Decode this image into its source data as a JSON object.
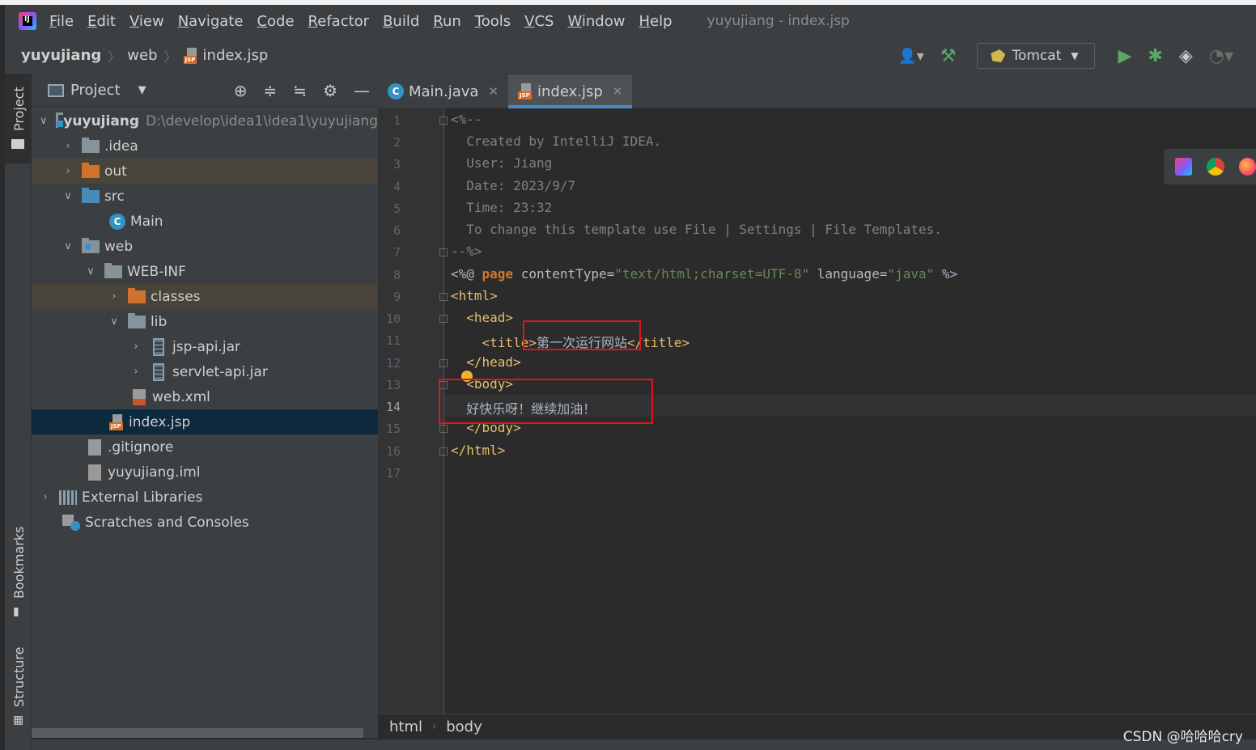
{
  "menu": {
    "items": [
      "File",
      "Edit",
      "View",
      "Navigate",
      "Code",
      "Refactor",
      "Build",
      "Run",
      "Tools",
      "VCS",
      "Window",
      "Help"
    ],
    "window_title": "yuyujiang - index.jsp"
  },
  "navbar": {
    "crumbs": [
      "yuyujiang",
      "web",
      "index.jsp"
    ],
    "run_config": "Tomcat"
  },
  "side_tabs": {
    "project": "Project",
    "bookmarks": "Bookmarks",
    "structure": "Structure"
  },
  "project_panel": {
    "title": "Project",
    "root_name": "yuyujiang",
    "root_path": "D:\\develop\\idea1\\idea1\\yuyujiang",
    "items": [
      ".idea",
      "out",
      "src",
      "Main",
      "web",
      "WEB-INF",
      "classes",
      "lib",
      "jsp-api.jar",
      "servlet-api.jar",
      "web.xml",
      "index.jsp",
      ".gitignore",
      "yuyujiang.iml",
      "External Libraries",
      "Scratches and Consoles"
    ]
  },
  "tabs": [
    {
      "label": "Main.java"
    },
    {
      "label": "index.jsp"
    }
  ],
  "editor": {
    "line_numbers": [
      "1",
      "2",
      "3",
      "4",
      "5",
      "6",
      "7",
      "8",
      "9",
      "10",
      "11",
      "12",
      "13",
      "14",
      "15",
      "16",
      "17"
    ],
    "current_line": 14,
    "comment_lines": [
      "<%--",
      "  Created by IntelliJ IDEA.",
      "  User: Jiang",
      "  Date: 2023/9/7",
      "  Time: 23:32",
      "  To change this template use File | Settings | File Templates.",
      "--%>"
    ],
    "directive": {
      "open": "<%@ ",
      "kw": "page",
      "attr1": " contentType=",
      "val1": "\"text/html;charset=UTF-8\"",
      "attr2": " language=",
      "val2": "\"java\"",
      "close": " %>"
    },
    "html_open": "<html>",
    "head_open": "  <head>",
    "title_open": "    <title>",
    "title_text": "第一次运行网站",
    "title_close": "</title>",
    "head_close": "  </head>",
    "body_open": "  <body>",
    "body_text": "  好快乐呀！继续加油！",
    "body_close": "  </body>",
    "html_close": "</html>"
  },
  "breadcrumbs": [
    "html",
    "body"
  ],
  "watermark": "CSDN @哈哈哈cry",
  "colors": {
    "background": "#2b2b2b",
    "panel": "#3c3f41",
    "selection": "#0d293e",
    "highlight_box": "#e0141e",
    "tag": "#e8bf6a",
    "keyword": "#cc7832",
    "string": "#6a8759"
  }
}
